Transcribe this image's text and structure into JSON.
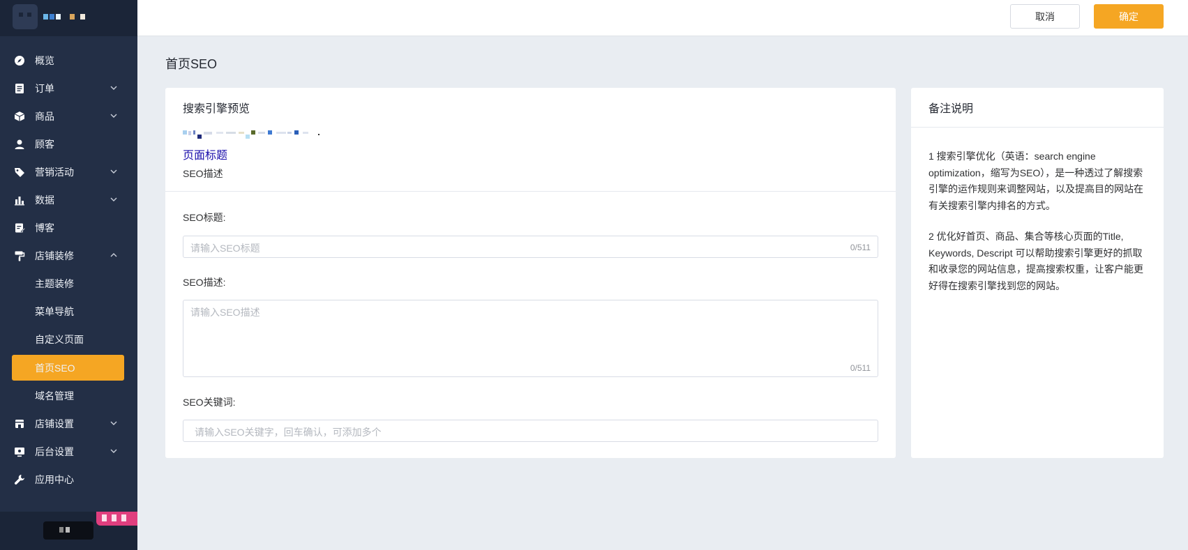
{
  "sidebar": {
    "items": [
      {
        "label": "概览",
        "icon": "compass-icon"
      },
      {
        "label": "订单",
        "icon": "order-list-icon"
      },
      {
        "label": "商品",
        "icon": "box-icon"
      },
      {
        "label": "顾客",
        "icon": "user-icon"
      },
      {
        "label": "营销活动",
        "icon": "tag-icon"
      },
      {
        "label": "数据",
        "icon": "bar-chart-icon"
      },
      {
        "label": "博客",
        "icon": "edit-doc-icon"
      },
      {
        "label": "店铺装修",
        "icon": "paint-roller-icon"
      },
      {
        "label": "店铺设置",
        "icon": "store-icon"
      },
      {
        "label": "后台设置",
        "icon": "monitor-icon"
      },
      {
        "label": "应用中心",
        "icon": "wrench-icon"
      }
    ],
    "sub_items": [
      "主题装修",
      "菜单导航",
      "自定义页面",
      "首页SEO",
      "域名管理"
    ],
    "active_sub": "首页SEO"
  },
  "header": {
    "cancel_label": "取消",
    "confirm_label": "确定"
  },
  "page": {
    "title": "首页SEO"
  },
  "preview": {
    "heading": "搜索引擎预览",
    "page_title": "页面标题",
    "description": "SEO描述"
  },
  "form": {
    "seo_title_label": "SEO标题:",
    "seo_title_placeholder": "请输入SEO标题",
    "seo_title_count": "0/511",
    "seo_desc_label": "SEO描述:",
    "seo_desc_placeholder": "请输入SEO描述",
    "seo_desc_count": "0/511",
    "seo_keywords_label": "SEO关键词:",
    "seo_keywords_placeholder": "请输入SEO关键字，回车确认，可添加多个"
  },
  "notes": {
    "heading": "备注说明",
    "para1": "1 搜索引擎优化（英语：search engine optimization，缩写为SEO），是一种透过了解搜索引擎的运作规则来调整网站，以及提高目的网站在有关搜索引擎内排名的方式。",
    "para2": "2 优化好首页、商品、集合等核心页面的Title, Keywords, Descript 可以帮助搜索引擎更好的抓取和收录您的网站信息，提高搜索权重，让客户能更好得在搜索引擎找到您的网站。"
  },
  "colors": {
    "sidebar_bg": "#232f46",
    "accent": "#f5a623",
    "page_bg": "#e9edf2",
    "link": "#1a0dab"
  }
}
